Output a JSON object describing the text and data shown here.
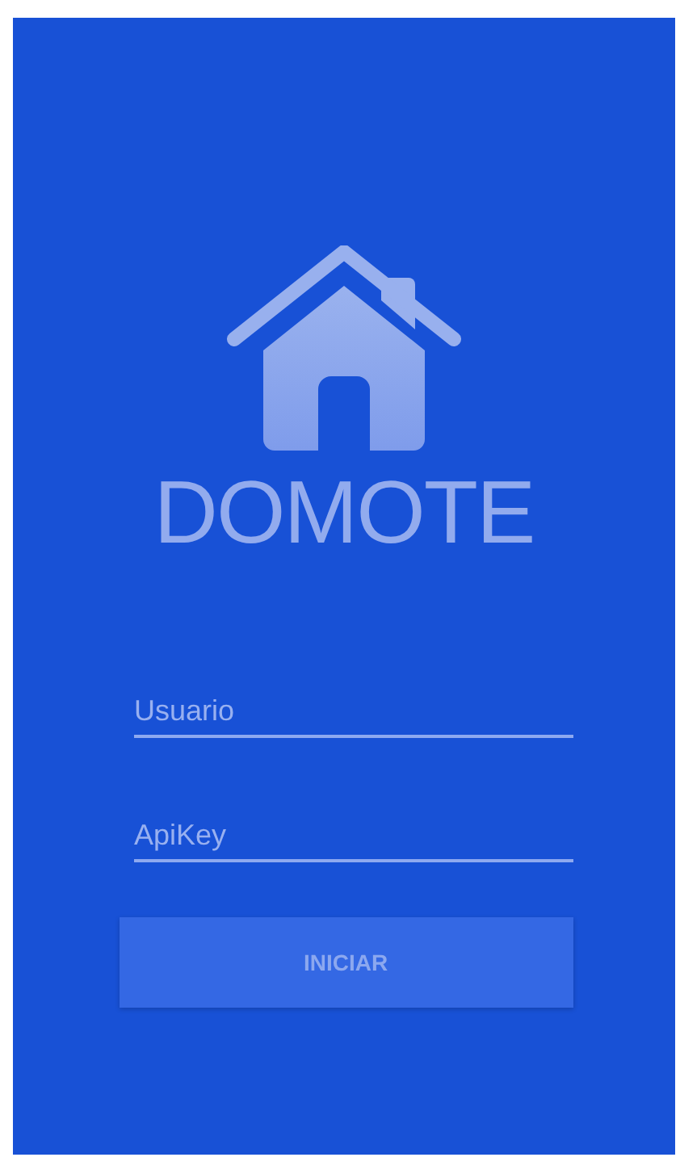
{
  "logo": {
    "title": "DOMOTE"
  },
  "fields": [
    {
      "placeholder": "Usuario"
    },
    {
      "placeholder": "ApiKey"
    }
  ],
  "button": {
    "label": "INICIAR"
  }
}
